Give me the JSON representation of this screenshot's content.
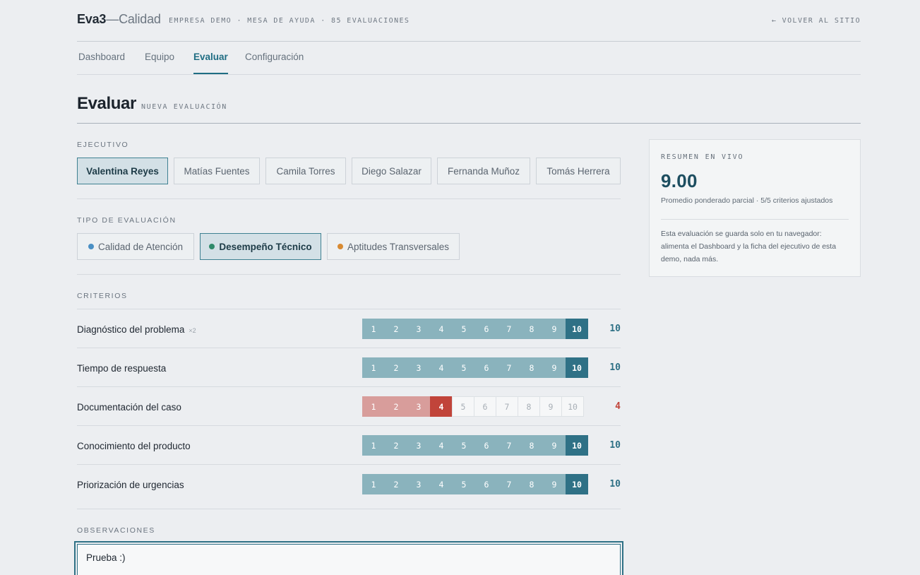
{
  "header": {
    "logo_bold": "Eva3",
    "logo_dash": "—",
    "logo_light": "Calidad",
    "meta": "EMPRESA DEMO · MESA DE AYUDA · 85 EVALUACIONES",
    "back_link": "← VOLVER AL SITIO"
  },
  "nav": {
    "tabs": [
      {
        "label": "Dashboard"
      },
      {
        "label": "Equipo"
      },
      {
        "label": "Evaluar",
        "active": true
      },
      {
        "label": "Configuración"
      }
    ]
  },
  "page": {
    "title": "Evaluar",
    "subtitle": "NUEVA EVALUACIÓN"
  },
  "ejecutivo": {
    "label": "EJECUTIVO",
    "options": [
      {
        "name": "Valentina Reyes",
        "selected": true
      },
      {
        "name": "Matías Fuentes"
      },
      {
        "name": "Camila Torres"
      },
      {
        "name": "Diego Salazar"
      },
      {
        "name": "Fernanda Muñoz"
      },
      {
        "name": "Tomás Herrera"
      }
    ]
  },
  "tipo": {
    "label": "TIPO DE EVALUACIÓN",
    "options": [
      {
        "name": "Calidad de Atención",
        "color": "#4a8fc4"
      },
      {
        "name": "Desempeño Técnico",
        "color": "#2f8a6a",
        "selected": true
      },
      {
        "name": "Aptitudes Transversales",
        "color": "#d88a32"
      }
    ]
  },
  "criterios": {
    "label": "CRITERIOS",
    "scale": [
      "1",
      "2",
      "3",
      "4",
      "5",
      "6",
      "7",
      "8",
      "9",
      "10"
    ],
    "items": [
      {
        "name": "Diagnóstico del problema",
        "weight": "×2",
        "score": "10"
      },
      {
        "name": "Tiempo de respuesta",
        "weight": "",
        "score": "10"
      },
      {
        "name": "Documentación del caso",
        "weight": "",
        "score": "4"
      },
      {
        "name": "Conocimiento del producto",
        "weight": "",
        "score": "10"
      },
      {
        "name": "Priorización de urgencias",
        "weight": "",
        "score": "10"
      }
    ]
  },
  "observaciones": {
    "label": "OBSERVACIONES",
    "value": "Prueba :)"
  },
  "resumen": {
    "label": "RESUMEN EN VIVO",
    "score": "9.00",
    "note": "Promedio ponderado parcial · 5/5 criterios ajustados",
    "description": "Esta evaluación se guarda solo en tu navegador: alimenta el Dashboard y la ficha del ejecutivo de esta demo, nada más."
  },
  "colors": {
    "accent": "#2f7186",
    "low_score": "#c1443a"
  }
}
